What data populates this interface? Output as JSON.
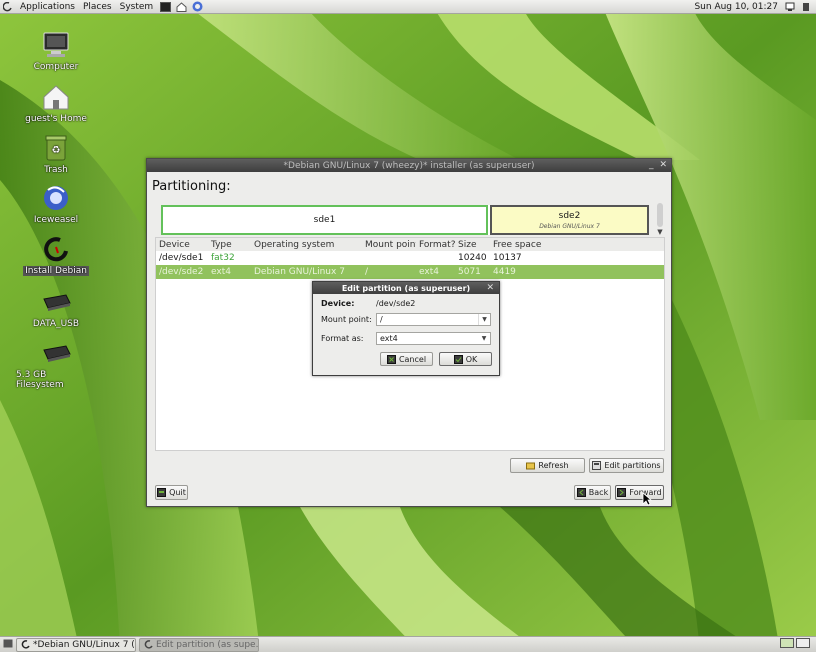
{
  "top_panel": {
    "menus": [
      "Applications",
      "Places",
      "System"
    ],
    "clock": "Sun Aug 10, 01:27"
  },
  "desktop_icons": [
    {
      "label": "Computer",
      "icon": "computer-icon"
    },
    {
      "label": "guest's Home",
      "icon": "home-icon"
    },
    {
      "label": "Trash",
      "icon": "trash-icon"
    },
    {
      "label": "Iceweasel",
      "icon": "iceweasel-icon"
    },
    {
      "label": "Install Debian",
      "icon": "installer-icon"
    },
    {
      "label": "DATA_USB",
      "icon": "drive-icon"
    },
    {
      "label": "5.3 GB Filesystem",
      "icon": "drive-icon"
    }
  ],
  "installer": {
    "title": "*Debian GNU/Linux 7 (wheezy)* installer (as superuser)",
    "heading": "Partitioning:",
    "partitions_bar": [
      {
        "name": "sde1",
        "sub": ""
      },
      {
        "name": "sde2",
        "sub": "Debian GNU/Linux 7"
      }
    ],
    "table": {
      "columns": [
        "Device",
        "Type",
        "Operating system",
        "Mount point",
        "Format?",
        "Size",
        "Free space"
      ],
      "rows": [
        [
          "/dev/sde1",
          "fat32",
          "",
          "",
          "",
          "10240",
          "10137"
        ],
        [
          "/dev/sde2",
          "ext4",
          "Debian GNU/Linux 7",
          "/",
          "ext4",
          "5071",
          "4419"
        ]
      ],
      "selected_row": 1
    },
    "buttons": {
      "refresh": "Refresh",
      "edit_partitions": "Edit partitions",
      "quit": "Quit",
      "back": "Back",
      "forward": "Forward"
    }
  },
  "dialog": {
    "title": "Edit partition (as superuser)",
    "device_label": "Device:",
    "device_value": "/dev/sde2",
    "mount_label": "Mount point:",
    "mount_value": "/",
    "format_label": "Format as:",
    "format_value": "ext4",
    "cancel": "Cancel",
    "ok": "OK"
  },
  "taskbar": [
    {
      "label": "*Debian GNU/Linux 7 (...",
      "active": false
    },
    {
      "label": "Edit partition (as supe...",
      "active": true
    }
  ],
  "colors": {
    "selection_green": "#91c25d",
    "partition_border_green": "#63c15a",
    "partition_fill_yellow": "#fbfbc5",
    "titlebar_dark": "#4a4a4a"
  }
}
